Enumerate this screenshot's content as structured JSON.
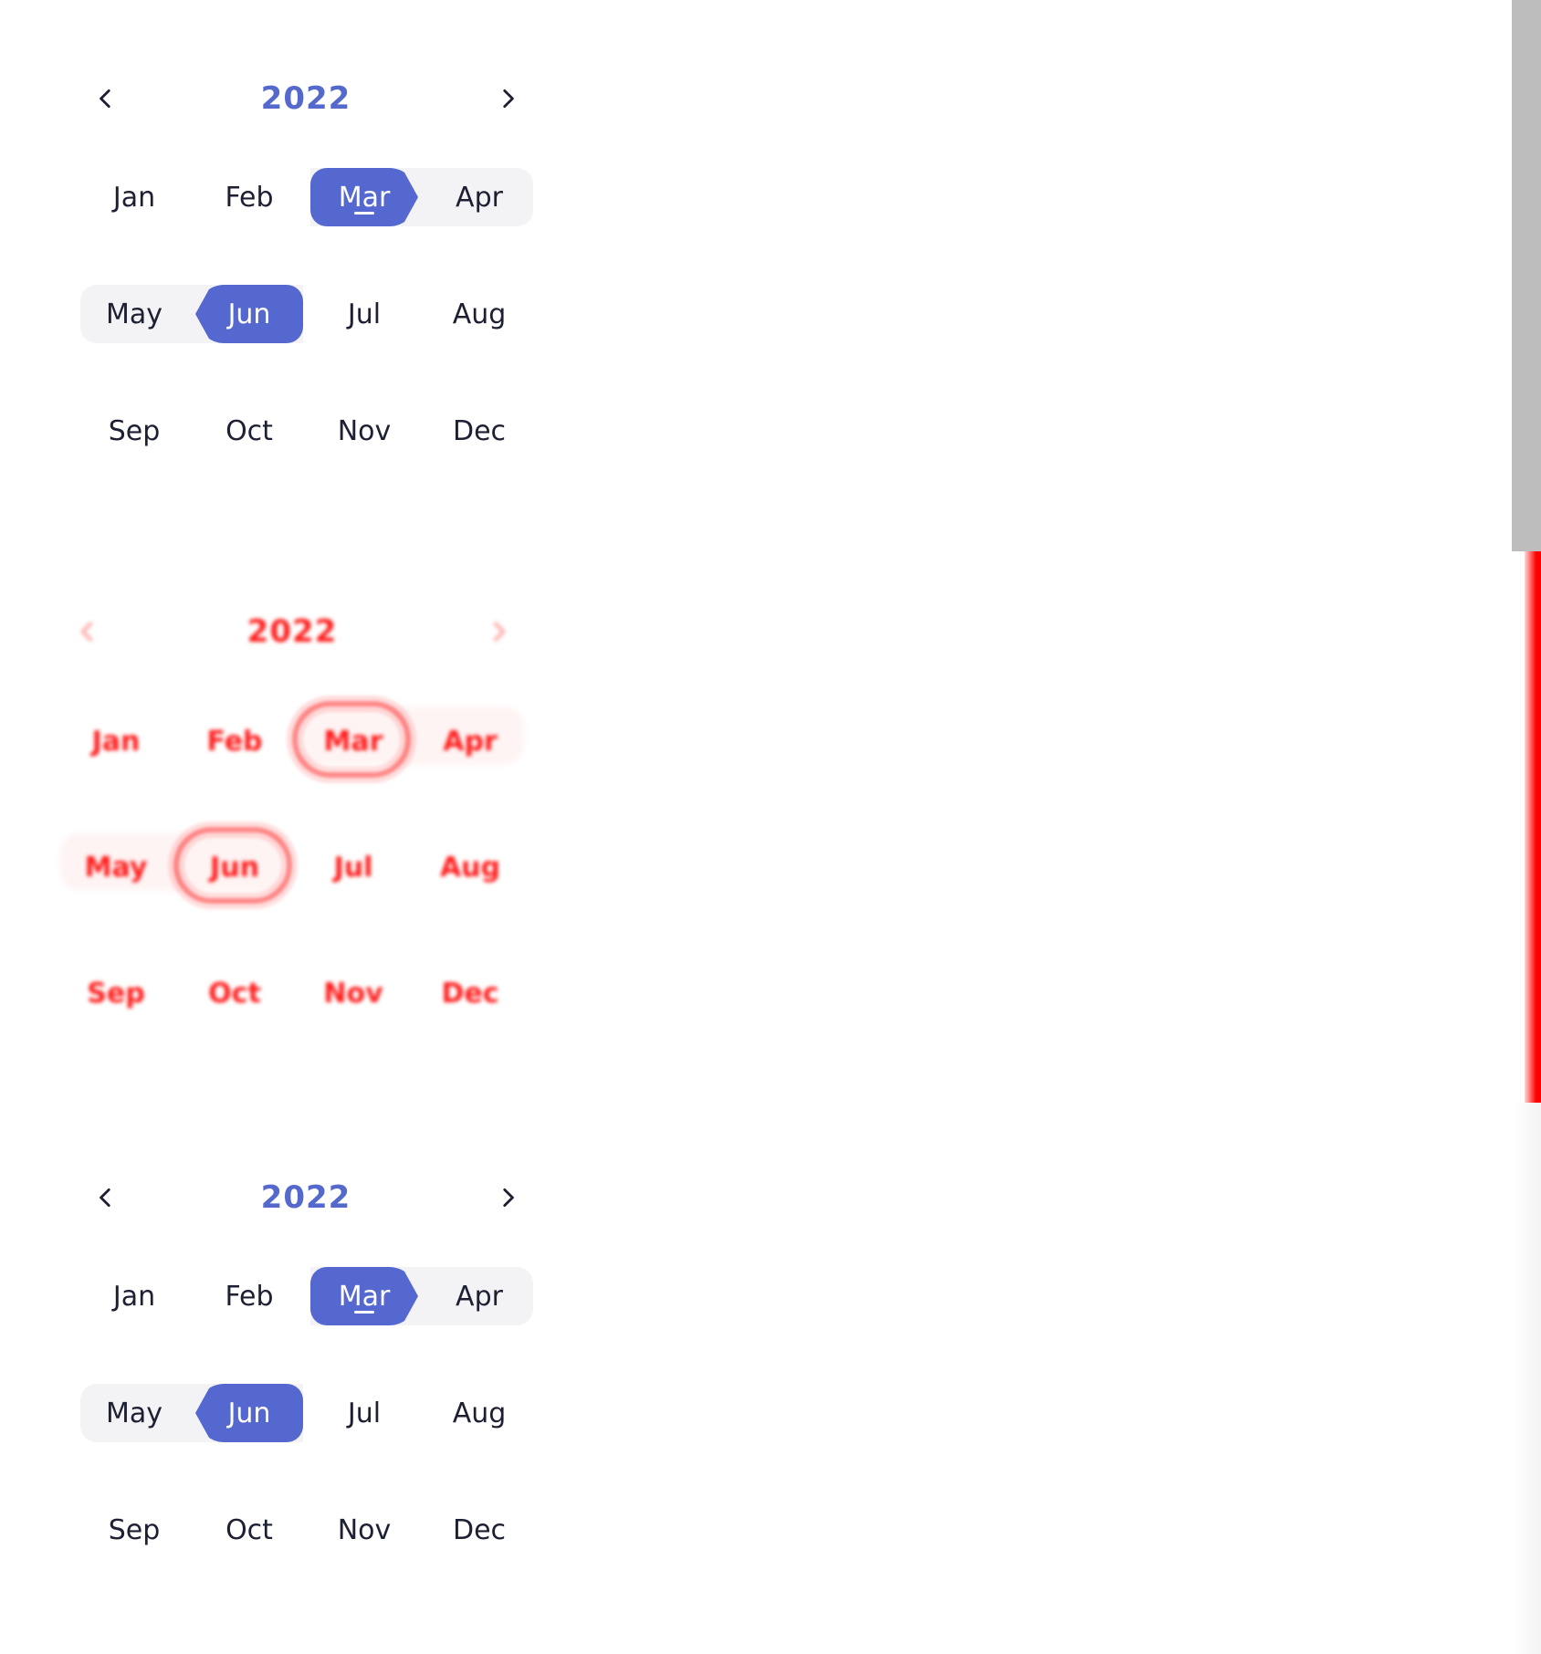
{
  "year": "2022",
  "months": [
    "Jan",
    "Feb",
    "Mar",
    "Apr",
    "May",
    "Jun",
    "Jul",
    "Aug",
    "Sep",
    "Oct",
    "Nov",
    "Dec"
  ],
  "range_start_month": "Mar",
  "range_end_month": "Jun",
  "focused_month": "Mar",
  "colors": {
    "accent": "#5568d0",
    "year_text": "#5568cc",
    "range_fill": "#f3f3f5",
    "text": "#1d1f33",
    "selected_text": "#ffffff",
    "diff_red": "#ff1a1a",
    "right_strip_gray": "#bdbdbd",
    "right_strip_red": "#ff0000"
  },
  "icons": {
    "prev": "chevron-left-icon",
    "next": "chevron-right-icon"
  }
}
